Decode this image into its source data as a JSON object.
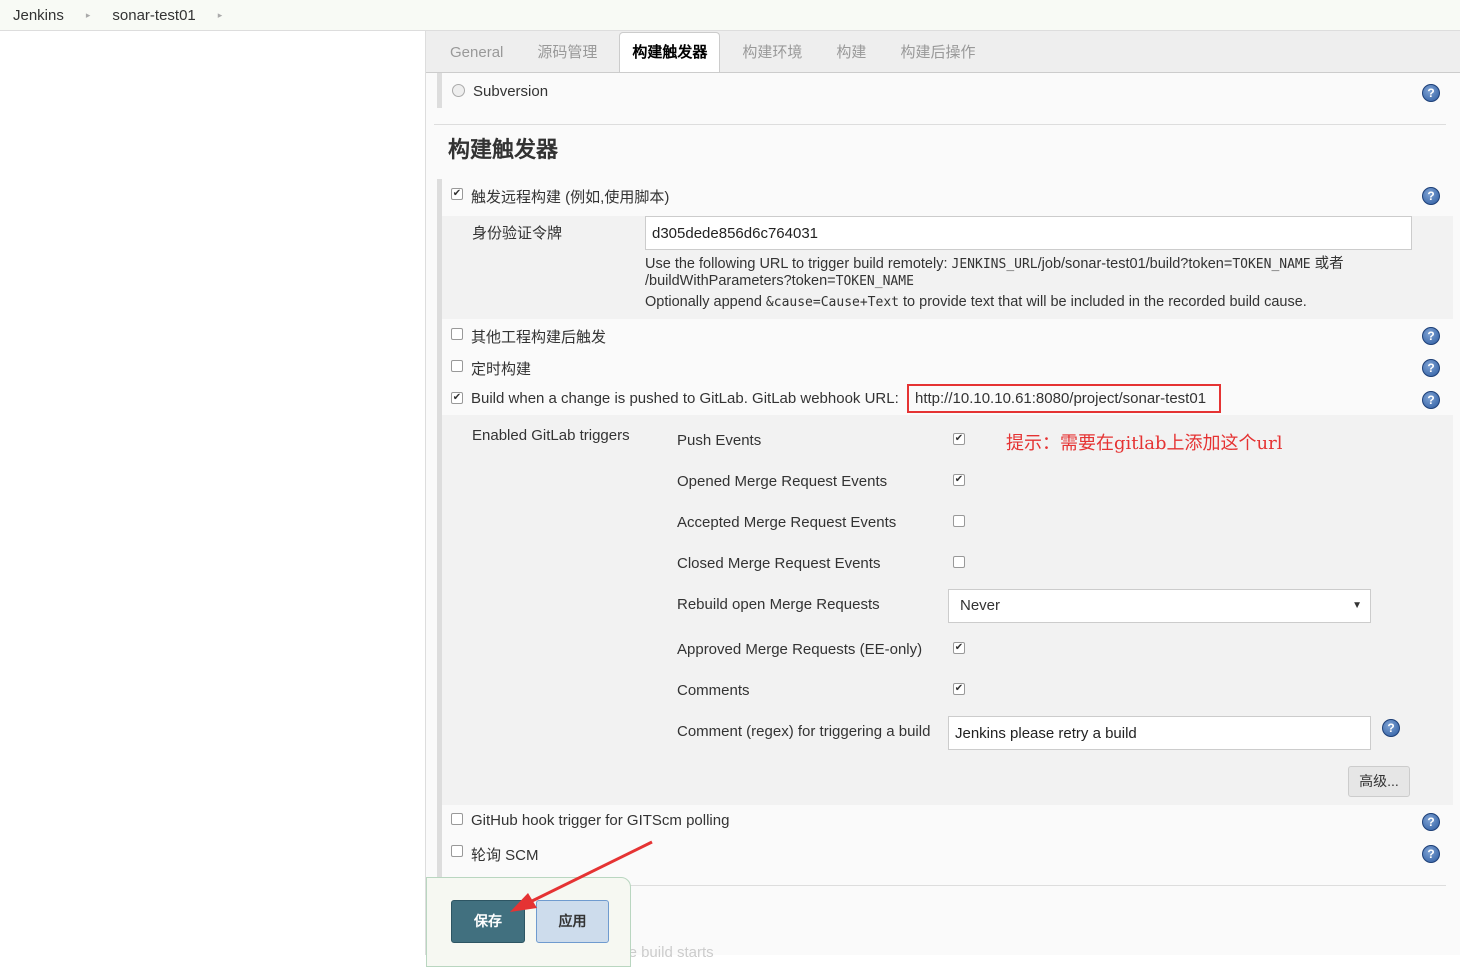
{
  "breadcrumb": [
    "Jenkins",
    "sonar-test01"
  ],
  "tabs": [
    "General",
    "源码管理",
    "构建触发器",
    "构建环境",
    "构建",
    "构建后操作"
  ],
  "scm_option": "Subversion",
  "section_title": "构建触发器",
  "remote": {
    "label": "触发远程构建 (例如,使用脚本)",
    "token_label": "身份验证令牌",
    "token_value": "d305dede856d6c764031",
    "help1a": "Use the following URL to trigger build remotely: ",
    "help1b": "JENKINS_URL",
    "help1c": "/job/sonar-test01/build?token=",
    "help1d": "TOKEN_NAME",
    "help1e": " 或者",
    "help2a": "/buildWithParameters?token=",
    "help2b": "TOKEN_NAME",
    "help3a": "Optionally append ",
    "help3b": "&cause=Cause+Text",
    "help3c": " to provide text that will be included in the recorded build cause."
  },
  "other_build": "其他工程构建后触发",
  "timer": "定时构建",
  "gitlab": {
    "label": "Build when a change is pushed to GitLab. GitLab webhook URL:",
    "url": "http://10.10.10.61:8080/project/sonar-test01",
    "triggers_label": "Enabled GitLab triggers",
    "annotation": "提示：需要在gitlab上添加这个url",
    "items": [
      {
        "label": "Push Events",
        "checked": true
      },
      {
        "label": "Opened Merge Request Events",
        "checked": true
      },
      {
        "label": "Accepted Merge Request Events",
        "checked": false
      },
      {
        "label": "Closed Merge Request Events",
        "checked": false
      }
    ],
    "rebuild_label": "Rebuild open Merge Requests",
    "rebuild_value": "Never",
    "approved": "Approved Merge Requests (EE-only)",
    "comments": "Comments",
    "comment_regex_label": "Comment (regex) for triggering a build",
    "comment_regex_value": "Jenkins please retry a build",
    "advanced": "高级..."
  },
  "github": "GitHub hook trigger for GITScm polling",
  "poll": "轮询 SCM",
  "save": "保存",
  "apply": "应用",
  "hidden_next": "Delete workspace before build starts",
  "colors": {
    "save": "#41707f",
    "annotation": "#e53333"
  }
}
